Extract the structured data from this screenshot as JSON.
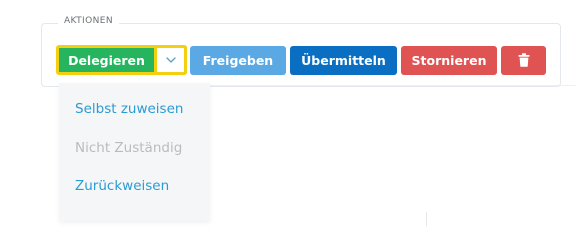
{
  "section": {
    "legend": "AKTIONEN"
  },
  "toolbar": {
    "delegate_label": "Delegieren",
    "dropdown_toggle_icon": "chevron-down-icon",
    "release_label": "Freigeben",
    "transmit_label": "Übermitteln",
    "cancel_label": "Stornieren",
    "delete_icon": "trash-icon"
  },
  "dropdown": {
    "items": [
      {
        "label": "Selbst zuweisen",
        "enabled": true
      },
      {
        "label": "Nicht Zuständig",
        "enabled": false
      },
      {
        "label": "Zurückweisen",
        "enabled": true
      }
    ]
  },
  "colors": {
    "delegate": "#27b45f",
    "focus_outline": "#f2cf0f",
    "release": "#5aa9e5",
    "transmit": "#0a6fc2",
    "cancel": "#e05353",
    "delete": "#e05353",
    "link": "#2a9bd3",
    "disabled_text": "#b9bcbf"
  }
}
